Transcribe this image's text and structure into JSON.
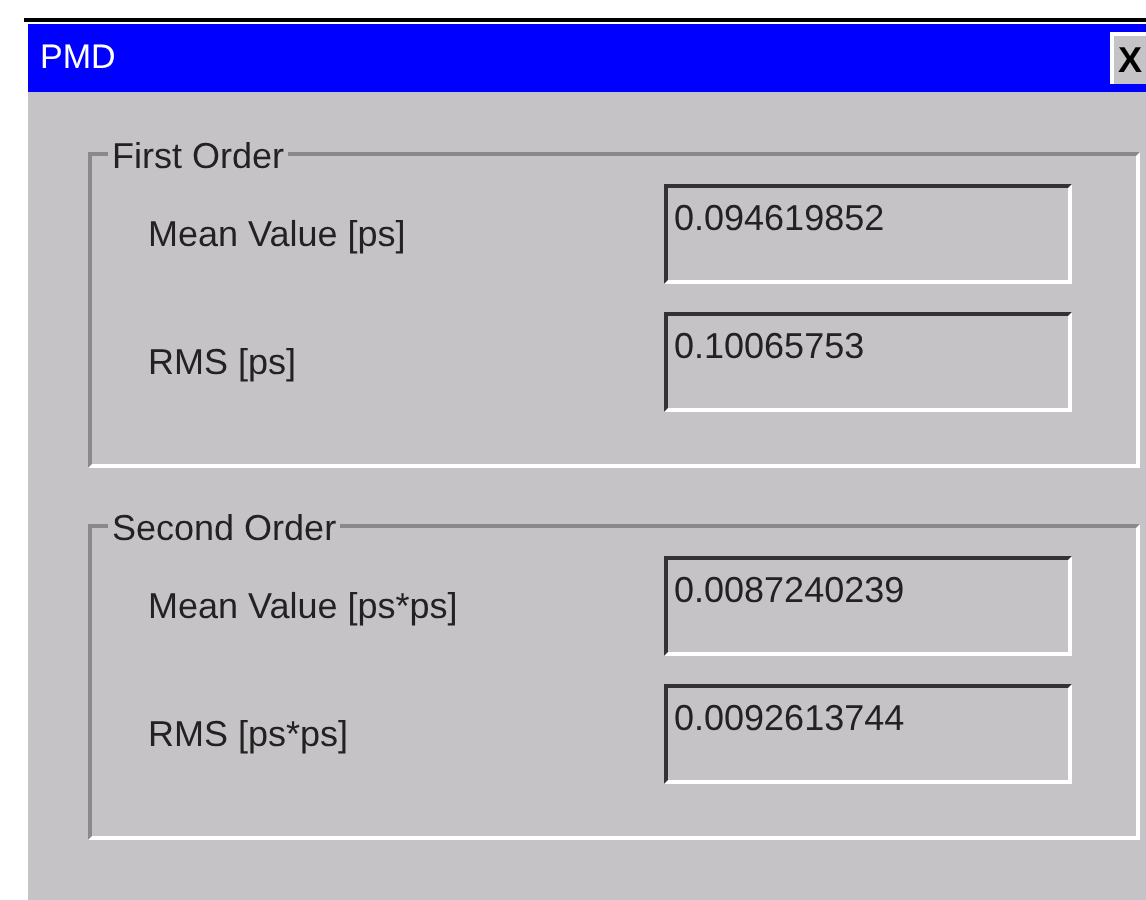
{
  "window": {
    "title": "PMD",
    "close": "X"
  },
  "groups": [
    {
      "title": "First Order",
      "rows": [
        {
          "label": "Mean Value [ps]",
          "value": "0.094619852"
        },
        {
          "label": "RMS [ps]",
          "value": "0.10065753"
        }
      ]
    },
    {
      "title": "Second Order",
      "rows": [
        {
          "label": "Mean Value [ps*ps]",
          "value": "0.0087240239"
        },
        {
          "label": "RMS [ps*ps]",
          "value": "0.0092613744"
        }
      ]
    }
  ]
}
